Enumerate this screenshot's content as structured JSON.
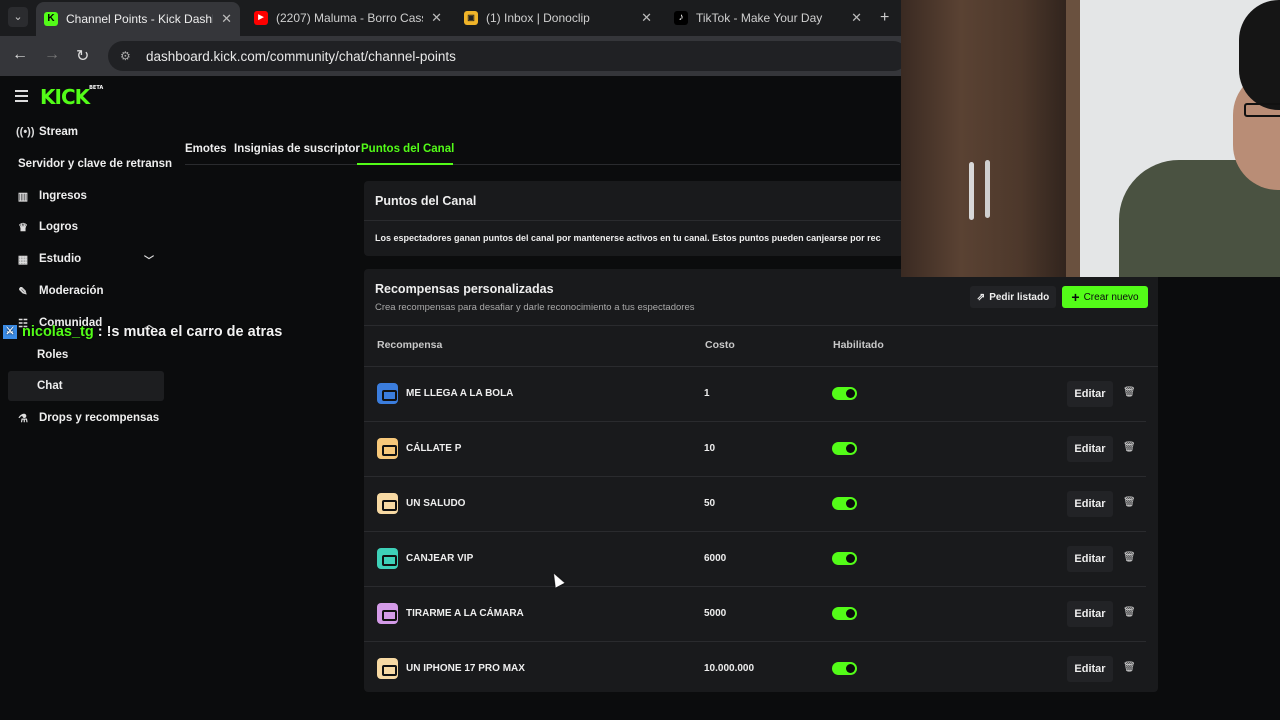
{
  "browser": {
    "tabs": [
      {
        "title": "Channel Points - Kick Dashboard",
        "favicon": "K",
        "favicon_color": "#53fc18"
      },
      {
        "title": "(2207) Maluma - Borro Cassette",
        "favicon": "▶",
        "favicon_color": "#ff0000"
      },
      {
        "title": "(1) Inbox | Donoclip",
        "favicon": "▣",
        "favicon_color": "#f0b429"
      },
      {
        "title": "TikTok - Make Your Day",
        "favicon": "♪",
        "favicon_color": "#ffffff"
      }
    ],
    "url": "dashboard.kick.com/community/chat/channel-points"
  },
  "logo": "KICK",
  "logo_badge": "BETA",
  "sidebar": {
    "items": [
      {
        "label": "Stream",
        "icon": "stream-icon"
      },
      {
        "label": "Servidor y clave de retransn"
      },
      {
        "label": "Ingresos",
        "icon": "chart-icon"
      },
      {
        "label": "Logros",
        "icon": "trophy-icon"
      },
      {
        "label": "Estudio",
        "icon": "studio-icon"
      },
      {
        "label": "Moderación",
        "icon": "wrench-icon"
      },
      {
        "label": "Comunidad",
        "icon": "community-icon"
      },
      {
        "label": "Roles"
      },
      {
        "label": "Chat"
      },
      {
        "label": "Drops y recompensas",
        "icon": "drops-icon"
      }
    ]
  },
  "content_tabs": {
    "emotes": "Emotes",
    "badges": "Insignias de suscriptor",
    "points": "Puntos del Canal"
  },
  "points_card": {
    "title": "Puntos del Canal",
    "description": "Los espectadores ganan puntos del canal por mantenerse activos en tu canal. Estos puntos pueden canjearse por rec"
  },
  "rewards": {
    "title": "Recompensas personalizadas",
    "subtitle": "Crea recompensas para desafiar y darle reconocimiento a tus espectadores",
    "request_list": "Pedir listado",
    "create_new": "Crear nuevo",
    "headers": {
      "reward": "Recompensa",
      "cost": "Costo",
      "enabled": "Habilitado"
    },
    "edit_label": "Editar",
    "rows": [
      {
        "name": "ME LLEGA A LA BOLA",
        "cost": "1",
        "color": "#3b7ddd"
      },
      {
        "name": "CÁLLATE P",
        "cost": "10",
        "color": "#f7c87a"
      },
      {
        "name": "UN SALUDO",
        "cost": "50",
        "color": "#f7d9a3"
      },
      {
        "name": "CANJEAR VIP",
        "cost": "6000",
        "color": "#3ed1b8"
      },
      {
        "name": "TIRARME A LA CÁMARA",
        "cost": "5000",
        "color": "#d49be8"
      },
      {
        "name": "UN IPHONE 17 PRO MAX",
        "cost": "10.000.000",
        "color": "#f7d9a3"
      }
    ]
  },
  "chat_overlay": {
    "user": "nicolas_tg",
    "message": " : !s mutea el carro de atras"
  },
  "colors": {
    "accent": "#53fc18",
    "background": "#0b0c0d",
    "card": "#191a1c"
  }
}
